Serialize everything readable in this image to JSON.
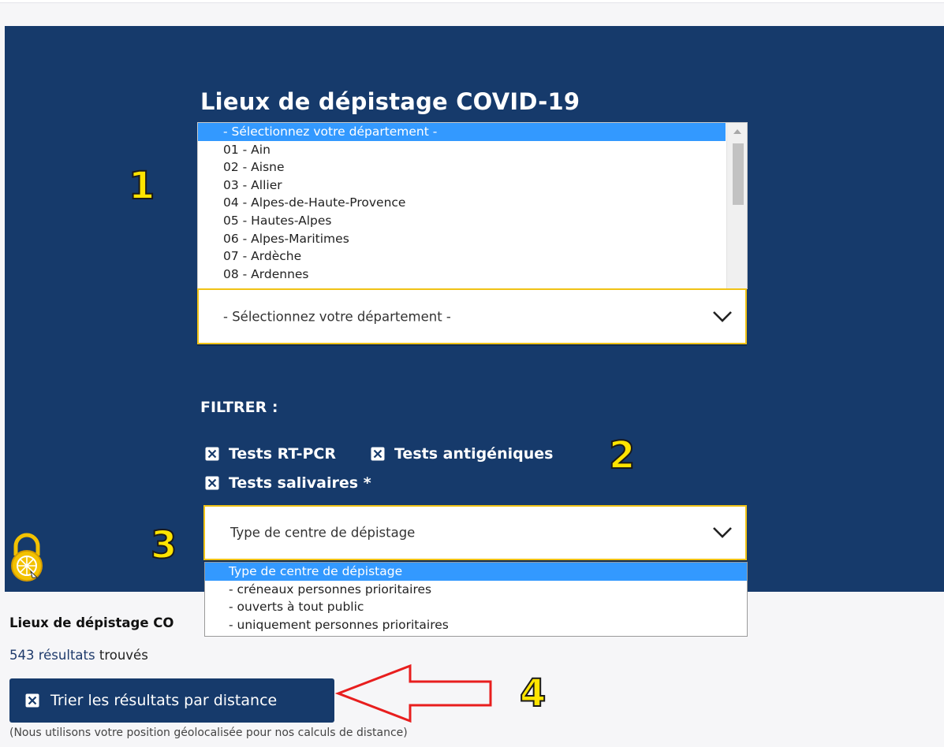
{
  "title": "Lieux de dépistage COVID-19",
  "department_list": {
    "selected": "- Sélectionnez votre département -",
    "options": [
      "01 - Ain",
      "02 - Aisne",
      "03 - Allier",
      "04 - Alpes-de-Haute-Provence",
      "05 - Hautes-Alpes",
      "06 - Alpes-Maritimes",
      "07 - Ardèche",
      "08 - Ardennes"
    ]
  },
  "department_select": {
    "value": "- Sélectionnez votre département -"
  },
  "filter": {
    "heading": "FILTRER :",
    "checkboxes": [
      {
        "label": "Tests RT-PCR",
        "checked": true
      },
      {
        "label": "Tests antigéniques",
        "checked": true
      },
      {
        "label": "Tests salivaires *",
        "checked": true
      }
    ]
  },
  "center_type_select": {
    "value": "Type de centre de dépistage",
    "options": [
      "Type de centre de dépistage",
      "- créneaux personnes prioritaires",
      "- ouverts à tout public",
      "- uniquement personnes prioritaires"
    ]
  },
  "results": {
    "title": "Lieux de dépistage CO",
    "count": "543 résultats",
    "count_suffix": " trouvés"
  },
  "sort_button": {
    "label": "Trier les résultats par distance",
    "checked": true
  },
  "geo_note": "(Nous utilisons votre position géolocalisée pour nos calculs de distance)",
  "annotations": [
    "1",
    "2",
    "3",
    "4"
  ],
  "colors": {
    "panel": "#163a6b",
    "highlight": "#3399ff",
    "select_border": "#f0c215",
    "annotation": "#ffe400",
    "arrow": "#e81e1e"
  }
}
